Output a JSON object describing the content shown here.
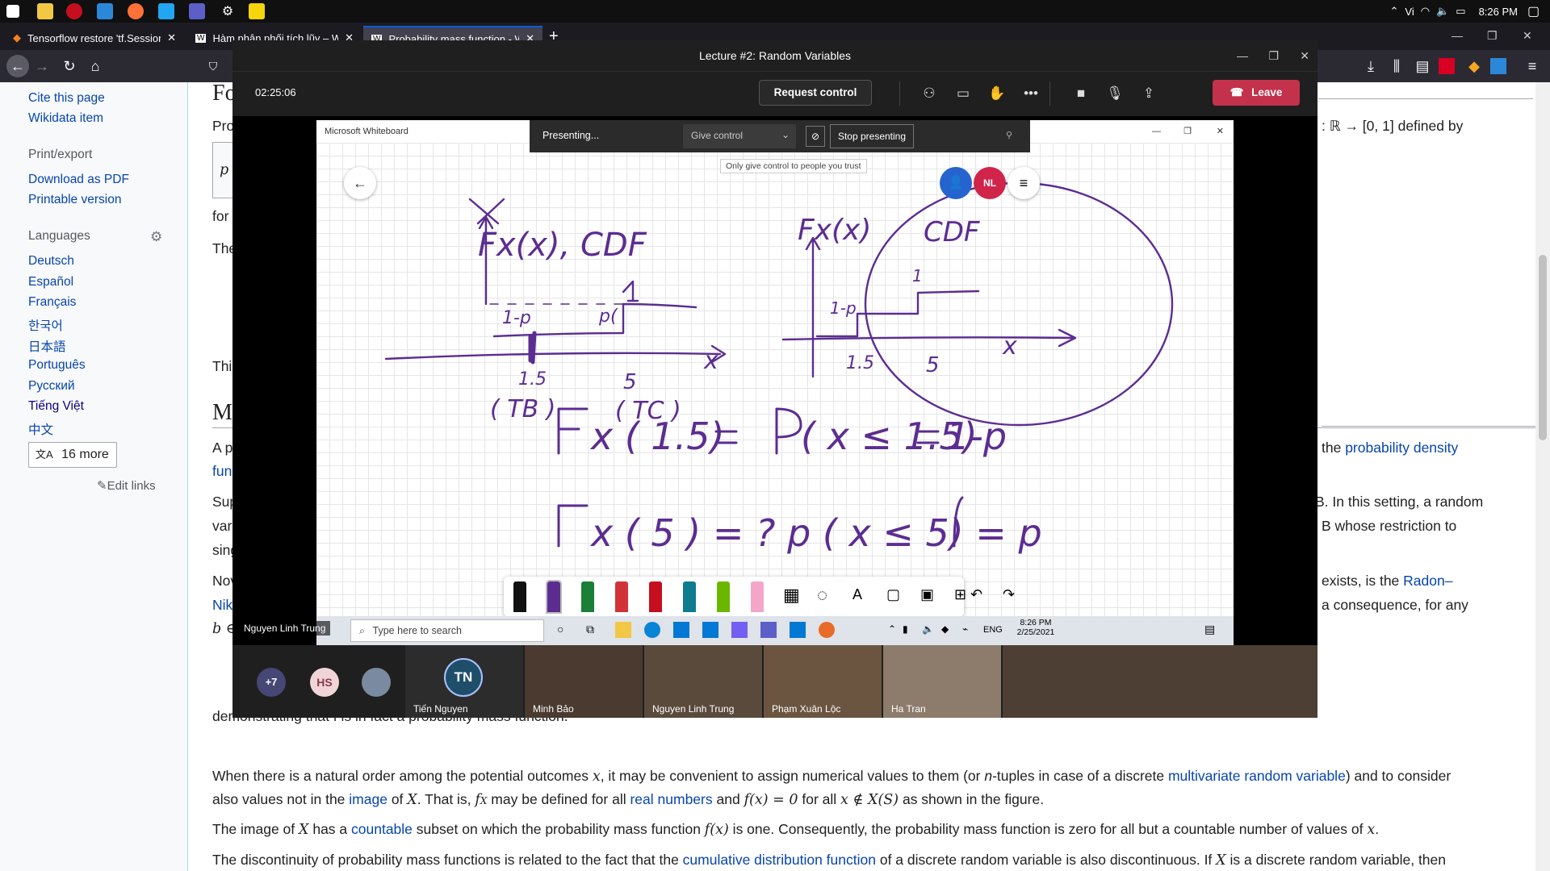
{
  "taskbar": {
    "language": "Vi",
    "time": "8:26 PM"
  },
  "browser": {
    "tabs": [
      {
        "label": "Tensorflow restore 'tf.Session'"
      },
      {
        "label": "Hàm phân phối tích lũy – Wiki"
      },
      {
        "label": "Probability mass function - Wiki"
      }
    ],
    "new_tab": "+"
  },
  "wiki_sidebar": {
    "cite": "Cite this page",
    "wikidata": "Wikidata item",
    "print_head": "Print/export",
    "download_pdf": "Download as PDF",
    "printable": "Printable version",
    "languages_head": "Languages",
    "langs": [
      "Deutsch",
      "Español",
      "Français",
      "한국어",
      "日本語",
      "Português",
      "Русский",
      "Tiếng Việt",
      "中文"
    ],
    "more_langs": "16 more",
    "edit_links": "Edit links"
  },
  "wiki_body": {
    "frag_fo": "Fo",
    "frag_pro": "Pro",
    "frag_px": "p",
    "frag_for": "for",
    "frag_the": "The",
    "frag_thi": "Thi",
    "frag_m": "M",
    "frag_ap": "A p",
    "frag_fun": "fun",
    "frag_sup": "Sup",
    "frag_var": "var",
    "frag_sing": "sing",
    "frag_nov": "Nov",
    "frag_nik": "Nik",
    "frag_b": "b ∈",
    "right_defined": ": ℝ → [0, 1] defined by",
    "right_prob_density_pre": "the ",
    "right_prob_density_link": "probability density",
    "right_setting": "B. In this setting, a random",
    "right_restriction": "B whose restriction to",
    "right_exists_pre": "exists, is the ",
    "right_radon": "Radon–",
    "right_consequence": "a consequence, for any",
    "demonstrating": "demonstrating that f is in fact a probability mass function.",
    "para1_a": "When there is a natural order among the potential outcomes ",
    "para1_x": "x",
    "para1_b": ", it may be convenient to assign numerical values to them (or ",
    "para1_n": "n",
    "para1_c": "-tuples in case of a discrete ",
    "para1_link": "multivariate random variable",
    "para1_d": ") and to consider",
    "para2_a": "also values not in the ",
    "para2_image": "image",
    "para2_b": " of ",
    "para2_X": "X",
    "para2_c": ". That is, ",
    "para2_fX": "f",
    "para2_d": " may be defined for all ",
    "para2_real": "real numbers",
    "para2_e": " and ",
    "para2_eq": "f(x) = 0",
    "para2_f": " for all ",
    "para2_cond": "x ∉ X(S)",
    "para2_g": " as shown in the figure.",
    "para3_a": "The image of ",
    "para3_X": "X",
    "para3_b": " has a ",
    "para3_countable": "countable",
    "para3_c": " subset on which the probability mass function ",
    "para3_fx": "f(x)",
    "para3_d": " is one. Consequently, the probability mass function is zero for all but a countable number of values of ",
    "para3_x": "x",
    "para3_e": ".",
    "para4_a": "The discontinuity of probability mass functions is related to the fact that the ",
    "para4_link": "cumulative distribution function",
    "para4_b": " of a discrete random variable is also discontinuous. If ",
    "para4_X": "X",
    "para4_c": " is a discrete random variable, then"
  },
  "teams": {
    "window_title": "Lecture #2: Random Variables",
    "timer": "02:25:06",
    "request_control": "Request control",
    "leave": "Leave",
    "whiteboard_title": "Microsoft Whiteboard",
    "presenting": "Presenting...",
    "give_control": "Give control",
    "stop_presenting": "Stop presenting",
    "tooltip": "Only give control to people you trust",
    "wb_avatar_initials": "NL",
    "presenter_name": "Nguyen Linh Trung",
    "inner_search": "Type here to search",
    "inner_lang": "ENG",
    "inner_time": "8:26 PM",
    "inner_date": "2/25/2021",
    "gallery_more": "+7",
    "gallery_hs": "HS",
    "participants": [
      {
        "initials": "TN",
        "name": "Tiến Nguyen"
      },
      {
        "name": "Minh Bảo"
      },
      {
        "name": "Nguyen Linh Trung"
      },
      {
        "name": "Phạm Xuân Lộc"
      },
      {
        "name": "Ha Tran"
      },
      {
        "name": ""
      }
    ]
  },
  "colors": {
    "teams_leave": "#c4314b",
    "ink": "#5c2d91",
    "wiki_link": "#0645ad",
    "avatar_blue": "#2564cf",
    "avatar_red": "#d1244a"
  }
}
